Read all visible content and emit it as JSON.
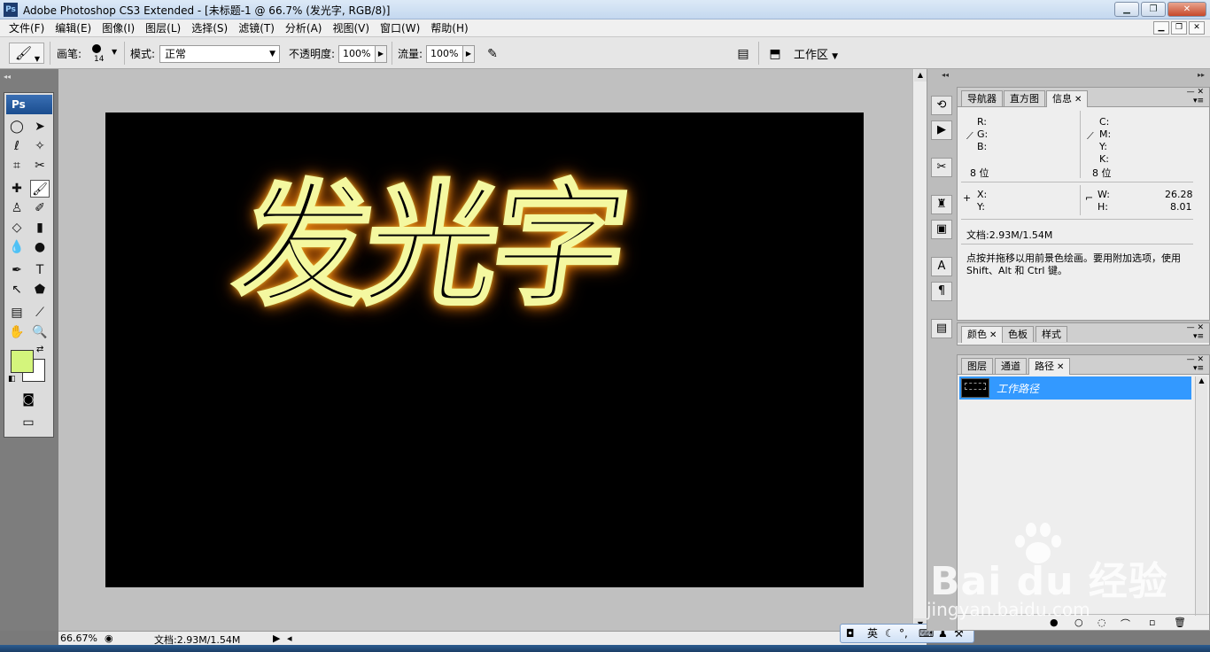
{
  "window": {
    "app_icon": "Ps",
    "title": "Adobe Photoshop CS3 Extended - [未标题-1 @ 66.7% (发光字, RGB/8)]",
    "buttons": [
      "minimize",
      "restore",
      "close"
    ]
  },
  "menu": {
    "items": [
      "文件(F)",
      "编辑(E)",
      "图像(I)",
      "图层(L)",
      "选择(S)",
      "滤镜(T)",
      "分析(A)",
      "视图(V)",
      "窗口(W)",
      "帮助(H)"
    ]
  },
  "options": {
    "brush_label": "画笔:",
    "brush_size": "14",
    "mode_label": "模式:",
    "mode_value": "正常",
    "opacity_label": "不透明度:",
    "opacity_value": "100%",
    "flow_label": "流量:",
    "flow_value": "100%",
    "workspace_label": "工作区"
  },
  "toolbox": {
    "logo": "Ps",
    "foreground_color": "#d4f57c",
    "background_color": "#ffffff"
  },
  "canvas": {
    "text": "发光字",
    "background": "#000000"
  },
  "info_panel": {
    "tabs": [
      "导航器",
      "直方图",
      "信息"
    ],
    "active_tab": "信息",
    "rgb_labels": [
      "R:",
      "G:",
      "B:"
    ],
    "cmyk_labels": [
      "C:",
      "M:",
      "Y:",
      "K:"
    ],
    "bit_left": "8 位",
    "bit_right": "8 位",
    "x_label": "X:",
    "y_label": "Y:",
    "w_label": "W:",
    "h_label": "H:",
    "w_value": "26.28",
    "h_value": "8.01",
    "doc_size": "文档:2.93M/1.54M",
    "hint": "点按并拖移以用前景色绘画。要用附加选项，使用 Shift、Alt 和 Ctrl 键。"
  },
  "color_panel": {
    "tabs": [
      "颜色",
      "色板",
      "样式"
    ],
    "active_tab": "颜色"
  },
  "paths_panel": {
    "tabs": [
      "图层",
      "通道",
      "路径"
    ],
    "active_tab": "路径",
    "paths": [
      "工作路径"
    ]
  },
  "status": {
    "zoom": "66.67%",
    "doc_size": "文档:2.93M/1.54M"
  },
  "ime": {
    "lang": "英"
  },
  "watermark": {
    "logo": "Bai du 经验",
    "url": "jingyan.baidu.com"
  }
}
